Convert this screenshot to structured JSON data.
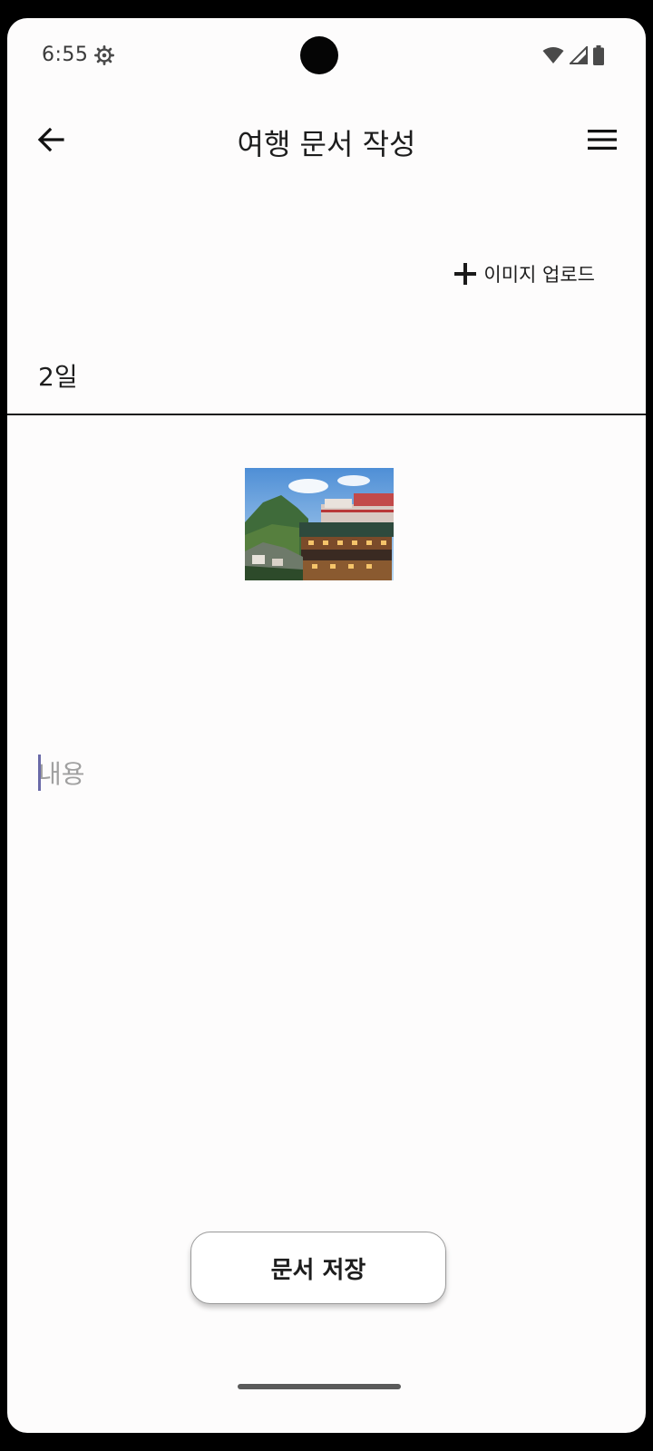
{
  "status_bar": {
    "time": "6:55",
    "icons": [
      "gear-icon",
      "wifi-icon",
      "signal-icon",
      "battery-icon"
    ]
  },
  "app_bar": {
    "title": "여행 문서 작성",
    "back_icon": "arrow-back-icon",
    "menu_icon": "hamburger-menu-icon"
  },
  "upload": {
    "label": "이미지 업로드",
    "icon": "plus-icon"
  },
  "day_field": {
    "value": "2일"
  },
  "content_field": {
    "placeholder": "내용"
  },
  "save_button": {
    "label": "문서 저장"
  },
  "colors": {
    "background": "#fdfcfc",
    "text": "#1d1d1d",
    "placeholder": "#a0a0a0",
    "divider": "#1a1a1a"
  }
}
